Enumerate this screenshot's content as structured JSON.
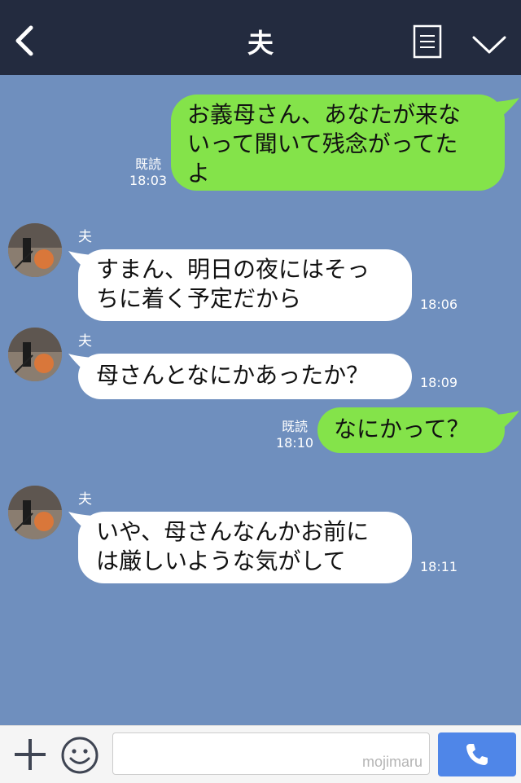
{
  "header": {
    "title": "夫"
  },
  "messages": [
    {
      "side": "mine",
      "text_lines": [
        "お義母さん、あなたが来な",
        "いって聞いて残念がってた",
        "よ"
      ],
      "read": "既読",
      "time": "18:03"
    },
    {
      "side": "theirs",
      "name": "夫",
      "text_lines": [
        "すまん、明日の夜にはそっ",
        "ちに着く予定だから"
      ],
      "time": "18:06"
    },
    {
      "side": "theirs",
      "name": "夫",
      "text_lines": [
        "母さんとなにかあったか？"
      ],
      "time": "18:09"
    },
    {
      "side": "mine",
      "text_lines": [
        "なにかって？"
      ],
      "read": "既読",
      "time": "18:10"
    },
    {
      "side": "theirs",
      "name": "夫",
      "text_lines": [
        "いや、母さんなんかお前に",
        "は厳しいような気がして"
      ],
      "time": "18:11"
    }
  ],
  "footer": {
    "watermark": "mojimaru"
  },
  "colors": {
    "header_bg": "#232b3f",
    "chat_bg": "#6f8fbe",
    "mine_bubble": "#84e34a",
    "theirs_bubble": "#ffffff",
    "call_button": "#4f86e8"
  },
  "icons": [
    "back-icon",
    "menu-icon",
    "chevron-down-icon",
    "plus-icon",
    "emoji-icon",
    "phone-icon"
  ]
}
